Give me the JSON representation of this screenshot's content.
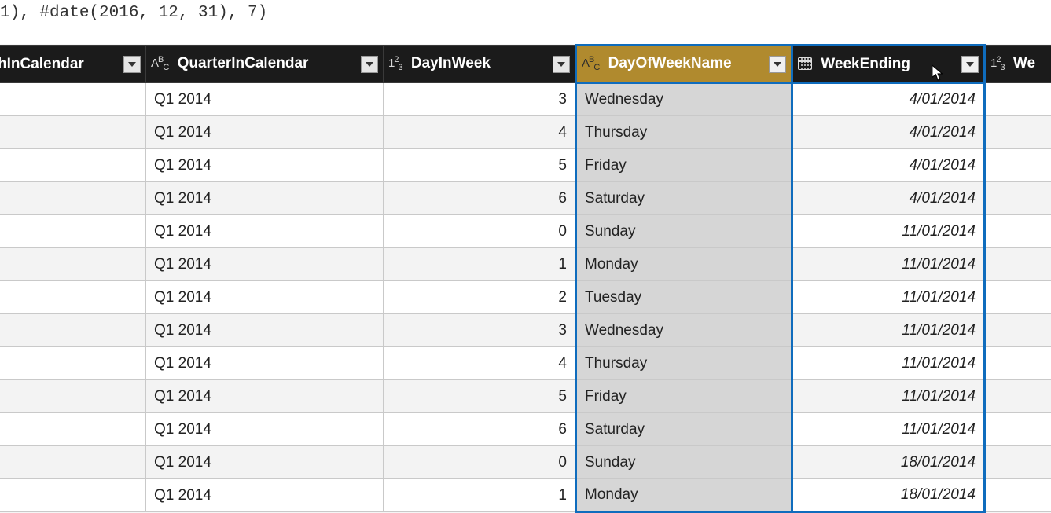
{
  "formula": "1), #date(2016, 12, 31), 7)",
  "columns": {
    "monthInCalendar": "hInCalendar",
    "quarterInCalendar": "QuarterInCalendar",
    "dayInWeek": "DayInWeek",
    "dayOfWeekName": "DayOfWeekName",
    "weekEnding": "WeekEnding",
    "partialNext": "We"
  },
  "typeIcons": {
    "text": "A",
    "number": "1",
    "date": "date"
  },
  "rows": [
    {
      "quarter": "Q1 2014",
      "dayInWeek": "3",
      "dayName": "Wednesday",
      "weekEnding": "4/01/2014"
    },
    {
      "quarter": "Q1 2014",
      "dayInWeek": "4",
      "dayName": "Thursday",
      "weekEnding": "4/01/2014"
    },
    {
      "quarter": "Q1 2014",
      "dayInWeek": "5",
      "dayName": "Friday",
      "weekEnding": "4/01/2014"
    },
    {
      "quarter": "Q1 2014",
      "dayInWeek": "6",
      "dayName": "Saturday",
      "weekEnding": "4/01/2014"
    },
    {
      "quarter": "Q1 2014",
      "dayInWeek": "0",
      "dayName": "Sunday",
      "weekEnding": "11/01/2014"
    },
    {
      "quarter": "Q1 2014",
      "dayInWeek": "1",
      "dayName": "Monday",
      "weekEnding": "11/01/2014"
    },
    {
      "quarter": "Q1 2014",
      "dayInWeek": "2",
      "dayName": "Tuesday",
      "weekEnding": "11/01/2014"
    },
    {
      "quarter": "Q1 2014",
      "dayInWeek": "3",
      "dayName": "Wednesday",
      "weekEnding": "11/01/2014"
    },
    {
      "quarter": "Q1 2014",
      "dayInWeek": "4",
      "dayName": "Thursday",
      "weekEnding": "11/01/2014"
    },
    {
      "quarter": "Q1 2014",
      "dayInWeek": "5",
      "dayName": "Friday",
      "weekEnding": "11/01/2014"
    },
    {
      "quarter": "Q1 2014",
      "dayInWeek": "6",
      "dayName": "Saturday",
      "weekEnding": "11/01/2014"
    },
    {
      "quarter": "Q1 2014",
      "dayInWeek": "0",
      "dayName": "Sunday",
      "weekEnding": "18/01/2014"
    },
    {
      "quarter": "Q1 2014",
      "dayInWeek": "1",
      "dayName": "Monday",
      "weekEnding": "18/01/2014"
    }
  ]
}
